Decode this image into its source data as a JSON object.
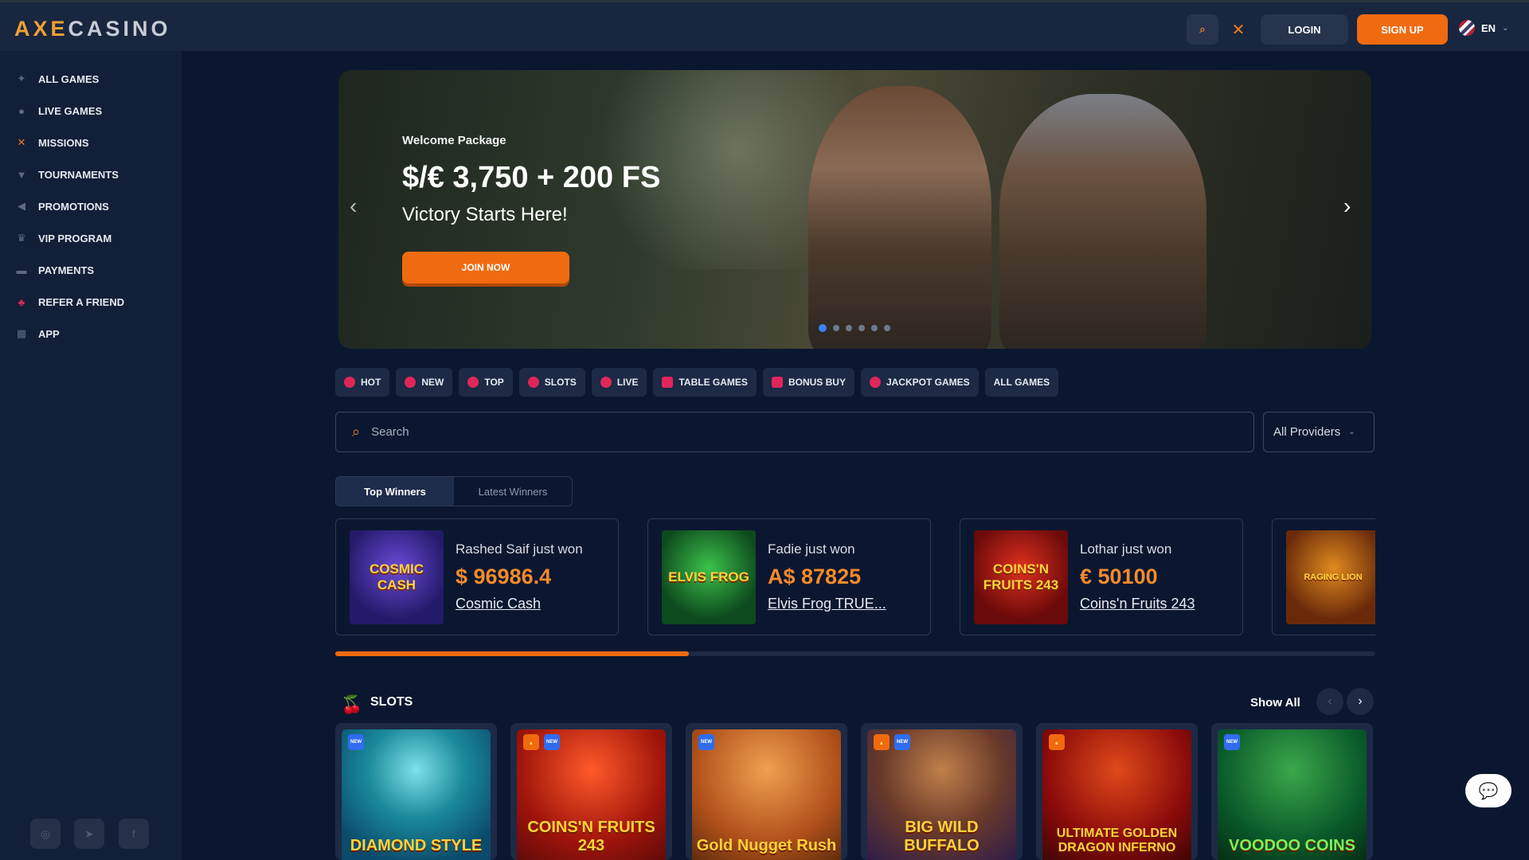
{
  "header": {
    "logo_part1": "AXE",
    "logo_part2": "CASINO",
    "login_label": "LOGIN",
    "signup_label": "SIGN UP",
    "language": "EN"
  },
  "sidebar": {
    "items": [
      {
        "label": "ALL GAMES",
        "icon": "grid-icon"
      },
      {
        "label": "LIVE GAMES",
        "icon": "live-icon"
      },
      {
        "label": "MISSIONS",
        "icon": "axes-icon"
      },
      {
        "label": "TOURNAMENTS",
        "icon": "trophy-icon"
      },
      {
        "label": "PROMOTIONS",
        "icon": "megaphone-icon"
      },
      {
        "label": "VIP PROGRAM",
        "icon": "crown-icon"
      },
      {
        "label": "PAYMENTS",
        "icon": "wallet-icon"
      },
      {
        "label": "REFER A FRIEND",
        "icon": "users-icon"
      },
      {
        "label": "APP",
        "icon": "apps-icon"
      }
    ]
  },
  "banner": {
    "eyebrow": "Welcome Package",
    "title": "$/€ 3,750 + 200 FS",
    "subtitle": "Victory Starts Here!",
    "cta": "JOIN NOW",
    "slide_count": 6,
    "active_slide": 1
  },
  "categories": [
    "HOT",
    "NEW",
    "TOP",
    "SLOTS",
    "LIVE",
    "TABLE GAMES",
    "BONUS BUY",
    "JACKPOT GAMES",
    "ALL GAMES"
  ],
  "search": {
    "placeholder": "Search",
    "providers_label": "All Providers"
  },
  "winners_tabs": {
    "top": "Top Winners",
    "latest": "Latest Winners",
    "active": "top"
  },
  "winners": [
    {
      "name": "Rashed Saif just won",
      "amount": "$ 96986.4",
      "game": "Cosmic Cash",
      "thumb_text": "COSMIC CASH"
    },
    {
      "name": "Fadie just won",
      "amount": "A$ 87825",
      "game": "Elvis Frog TRUE...",
      "thumb_text": "ELVIS FROG"
    },
    {
      "name": "Lothar just won",
      "amount": "€ 50100",
      "game": "Coins'n Fruits 243",
      "thumb_text": "COINS'N FRUITS 243"
    },
    {
      "name": "",
      "amount": "",
      "game": "",
      "thumb_text": "RAGING LION"
    }
  ],
  "winners_progress": 0.34,
  "slots_section": {
    "title": "SLOTS",
    "show_all": "Show All",
    "games": [
      {
        "title": "DIAMOND STYLE",
        "badge": "NEW",
        "hot": false
      },
      {
        "title": "COINS'N FRUITS 243",
        "badge": "NEW",
        "hot": true
      },
      {
        "title": "Gold Nugget Rush",
        "badge": "NEW",
        "hot": false
      },
      {
        "title": "BIG WILD BUFFALO",
        "badge": "NEW",
        "hot": true
      },
      {
        "title": "ULTIMATE GOLDEN DRAGON INFERNO",
        "badge": "",
        "hot": true
      },
      {
        "title": "VOODOO COINS",
        "badge": "NEW",
        "hot": false
      }
    ]
  },
  "colors": {
    "accent": "#f06a10",
    "background": "#0b1730",
    "hot": "#e0265a",
    "new_badge": "#2f6cf0"
  }
}
